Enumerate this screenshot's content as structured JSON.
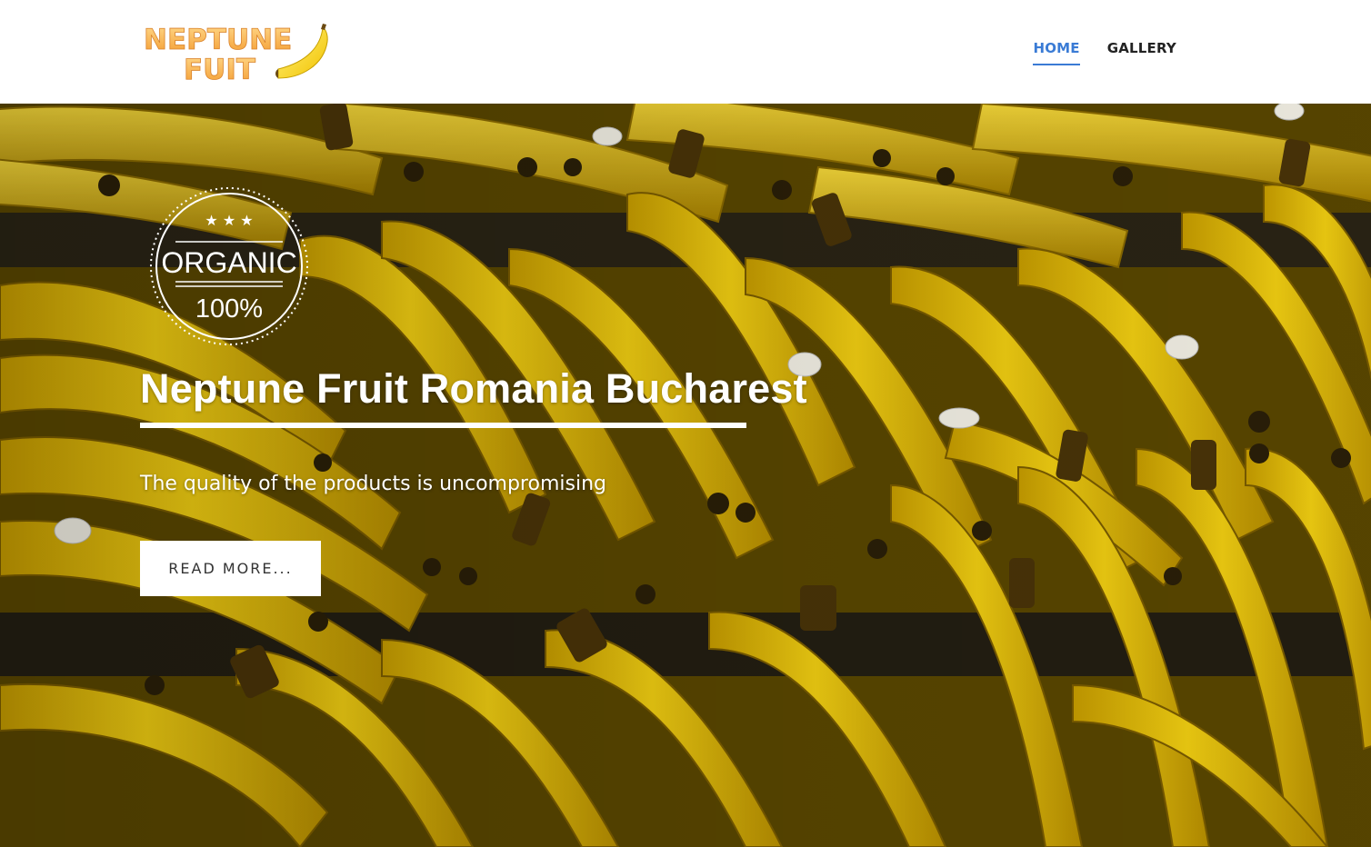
{
  "header": {
    "logo": {
      "line1": "NEPTUNE",
      "line2": "FUIT"
    },
    "nav": [
      {
        "label": "HOME",
        "active": true
      },
      {
        "label": "GALLERY",
        "active": false
      }
    ]
  },
  "hero": {
    "badge": {
      "stars": "★ ★ ★",
      "top_text": "ORGANIC",
      "bottom_text": "100%"
    },
    "title": "Neptune Fruit Romania Bucharest",
    "subtitle": "The quality of the products is uncompromising",
    "cta_label": "READ MORE..."
  },
  "colors": {
    "nav_active": "#3a7bd5",
    "logo_orange": "#f7a840",
    "banana_yellow": "#e8c200"
  },
  "icons": [
    "banana-icon",
    "organic-badge-icon",
    "star-icon"
  ]
}
